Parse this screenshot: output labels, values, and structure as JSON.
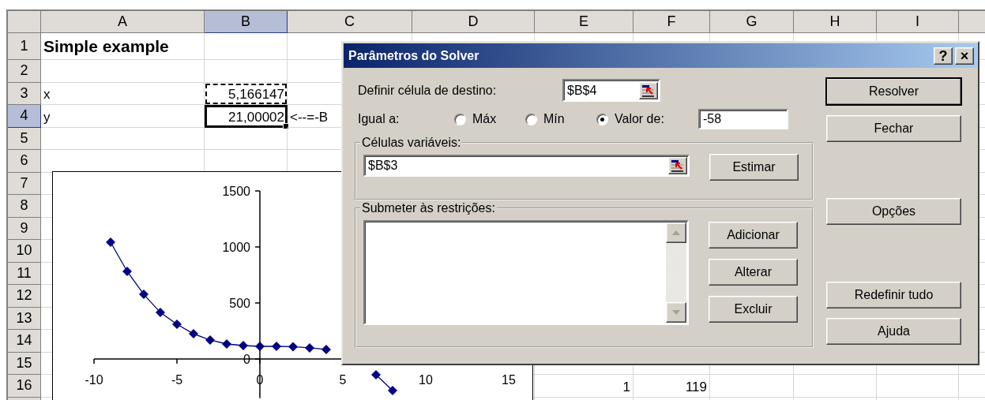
{
  "sheet": {
    "columns": [
      {
        "label": "A",
        "selected": false
      },
      {
        "label": "B",
        "selected": true
      },
      {
        "label": "C",
        "selected": false
      },
      {
        "label": "D",
        "selected": false
      },
      {
        "label": "E",
        "selected": false
      },
      {
        "label": "F",
        "selected": false
      },
      {
        "label": "G",
        "selected": false
      },
      {
        "label": "H",
        "selected": false
      },
      {
        "label": "I",
        "selected": false
      }
    ],
    "rows": [
      {
        "label": "1",
        "selected": false,
        "a": {
          "text": "Simple example",
          "kind": "title"
        }
      },
      {
        "label": "2",
        "selected": false
      },
      {
        "label": "3",
        "selected": false,
        "a": {
          "text": "x",
          "kind": "label"
        },
        "b": {
          "text": "5,166147",
          "kind": "number",
          "copied": true
        }
      },
      {
        "label": "4",
        "selected": true,
        "a": {
          "text": "y",
          "kind": "label"
        },
        "b": {
          "text": "21,00002",
          "kind": "number",
          "selected": true
        },
        "c": {
          "text": "<--=-B",
          "kind": "label"
        }
      },
      {
        "label": "5",
        "selected": false
      },
      {
        "label": "6",
        "selected": false
      },
      {
        "label": "7",
        "selected": false
      },
      {
        "label": "8",
        "selected": false
      },
      {
        "label": "9",
        "selected": false
      },
      {
        "label": "10",
        "selected": false
      },
      {
        "label": "11",
        "selected": false
      },
      {
        "label": "12",
        "selected": false
      },
      {
        "label": "13",
        "selected": false
      },
      {
        "label": "14",
        "selected": false
      },
      {
        "label": "15",
        "selected": false
      },
      {
        "label": "16",
        "selected": false,
        "e": {
          "text": "1",
          "kind": "number"
        },
        "f": {
          "text": "119",
          "kind": "number"
        }
      }
    ]
  },
  "chart": {
    "chart_data": {
      "type": "line",
      "x": [
        -9,
        -8,
        -7,
        -6,
        -5,
        -4,
        -3,
        -2,
        -1,
        0,
        1,
        2,
        3,
        4,
        5,
        6,
        7,
        8
      ],
      "values": [
        1042,
        782,
        577,
        415,
        310,
        225,
        169,
        134,
        120,
        113,
        113,
        110,
        99,
        85,
        null,
        null,
        -141,
        -282
      ],
      "marker": "diamond",
      "xlim": [
        -10,
        15
      ],
      "ylim": [
        -350,
        1500
      ],
      "xticks": [
        -10,
        -5,
        0,
        5,
        10,
        15
      ],
      "yticks": [
        0,
        500,
        1000,
        1500
      ]
    }
  },
  "dialog": {
    "title": "Parâmetros do Solver",
    "title_buttons": [
      "?",
      "×"
    ],
    "target": {
      "label": "Definir célula de destino:",
      "value": "$B$4"
    },
    "equal_to": {
      "label": "Igual a:",
      "options": [
        {
          "label": "Máx",
          "selected": false
        },
        {
          "label": "Mín",
          "selected": false
        },
        {
          "label": "Valor de:",
          "selected": true
        }
      ],
      "value": "-58"
    },
    "variable_cells": {
      "label": "Células variáveis:",
      "value": "$B$3",
      "button": {
        "label": "Estimar"
      }
    },
    "constraints": {
      "label": "Submeter às restrições:",
      "buttons": [
        {
          "label": "Adicionar"
        },
        {
          "label": "Alterar"
        },
        {
          "label": "Excluir"
        }
      ]
    },
    "side_buttons": [
      {
        "label": "Resolver",
        "default": true
      },
      {
        "label": "Fechar",
        "default": false
      },
      {
        "label": "Opções",
        "default": false
      },
      {
        "label": "Redefinir tudo",
        "default": false
      },
      {
        "label": "Ajuda",
        "default": false
      }
    ]
  }
}
